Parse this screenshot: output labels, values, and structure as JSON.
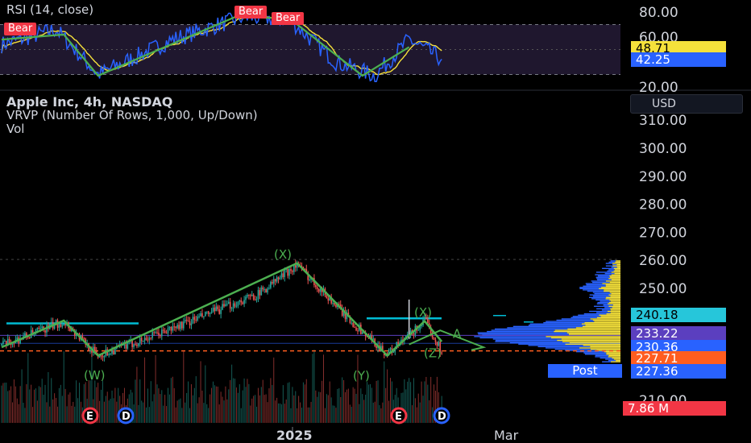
{
  "header": {
    "rsi_title": "RSI (14, close)",
    "symbol": "Apple Inc, 4h, NASDAQ",
    "vrvp": "VRVP (Number Of Rows, 1,000, Up/Down)",
    "vol": "Vol",
    "currency": "USD"
  },
  "rsi_panel": {
    "ticks": [
      "80.00",
      "60.00",
      "20.00"
    ],
    "rsi_value": "42.25",
    "rsi_ma_value": "48.71",
    "signals": [
      "Bear",
      "Bear",
      "Bear"
    ]
  },
  "price_axis": {
    "ticks": [
      "310.00",
      "300.00",
      "290.00",
      "280.00",
      "270.00",
      "260.00",
      "250.00",
      "210.00"
    ],
    "badges": {
      "level_240": "240.18",
      "level_233": "233.22",
      "level_230": "230.36",
      "last_price": "227.71",
      "post_price": "227.36",
      "volume": "7.86 M"
    },
    "post_label": "Post"
  },
  "time_axis": {
    "labels": [
      "2025",
      "Mar"
    ]
  },
  "wave_labels": {
    "x1": "(X)",
    "w": "(W)",
    "y": "(Y)",
    "x2": "(X)",
    "z": "(Z)",
    "a": "A"
  },
  "events": [
    "E",
    "D",
    "E",
    "D"
  ],
  "colors": {
    "up": "#26a69a",
    "down": "#ef5350",
    "rsi": "#2962ff",
    "rsi_ma": "#f5e13b",
    "wave": "#4caf50",
    "cyan": "#00bcd4",
    "last": "#ff5d1f",
    "purple": "#5b3fbf",
    "bear": "#f23645",
    "profile_up": "#2962ff",
    "profile_down": "#f5e13b"
  },
  "chart_data": {
    "type": "candlestick",
    "timeframe": "4h",
    "x_labels": [
      "2025",
      "Mar"
    ],
    "ylim": [
      210,
      310
    ],
    "anchors": [
      {
        "i": 0,
        "price": 229.5
      },
      {
        "i": 40,
        "price": 238.2
      },
      {
        "i": 62,
        "price": 226.0
      },
      {
        "i": 100,
        "price": 233.5
      },
      {
        "i": 165,
        "price": 248.0
      },
      {
        "i": 190,
        "price": 258.6
      },
      {
        "i": 225,
        "price": 238.0
      },
      {
        "i": 248,
        "price": 226.6
      },
      {
        "i": 262,
        "price": 233.0
      },
      {
        "i": 272,
        "price": 238.5
      },
      {
        "i": 283,
        "price": 227.7
      }
    ],
    "key_levels": [
      240.18,
      233.22,
      230.36,
      227.71,
      227.36
    ],
    "rsi": {
      "ylim": [
        20,
        80
      ],
      "band": [
        30,
        70
      ],
      "last": 42.25,
      "ma_last": 48.71,
      "anchors": [
        {
          "i": 0,
          "v": 54
        },
        {
          "i": 35,
          "v": 66
        },
        {
          "i": 62,
          "v": 30
        },
        {
          "i": 110,
          "v": 58
        },
        {
          "i": 155,
          "v": 76
        },
        {
          "i": 185,
          "v": 74
        },
        {
          "i": 215,
          "v": 40
        },
        {
          "i": 240,
          "v": 29
        },
        {
          "i": 262,
          "v": 58
        },
        {
          "i": 283,
          "v": 42.25
        }
      ]
    },
    "volume_last": "7.86 M"
  }
}
